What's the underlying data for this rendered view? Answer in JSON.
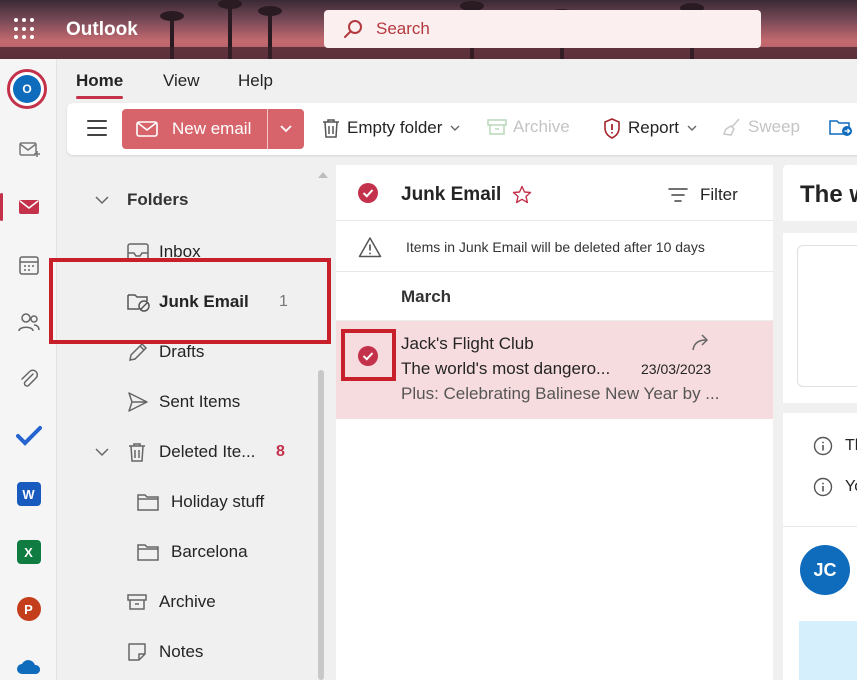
{
  "header": {
    "app_title": "Outlook",
    "search_placeholder": "Search"
  },
  "ribbon": {
    "tabs": [
      {
        "label": "Home",
        "active": true
      },
      {
        "label": "View"
      },
      {
        "label": "Help"
      }
    ]
  },
  "toolbar": {
    "new_email": "New email",
    "empty_folder": "Empty folder",
    "archive": "Archive",
    "report": "Report",
    "sweep": "Sweep"
  },
  "folders": {
    "section_title": "Folders",
    "items": [
      {
        "label": "Inbox",
        "icon": "inbox-icon"
      },
      {
        "label": "Junk Email",
        "count": "1",
        "selected": true,
        "icon": "junk-folder-icon"
      },
      {
        "label": "Drafts",
        "icon": "pencil-icon"
      },
      {
        "label": "Sent Items",
        "icon": "send-icon"
      },
      {
        "label": "Deleted Ite...",
        "count": "8",
        "icon": "trash-icon"
      },
      {
        "label": "Holiday stuff",
        "icon": "folder-icon"
      },
      {
        "label": "Barcelona",
        "icon": "folder-icon"
      },
      {
        "label": "Archive",
        "icon": "archive-icon"
      },
      {
        "label": "Notes",
        "icon": "note-icon"
      }
    ]
  },
  "message_list": {
    "title": "Junk Email",
    "filter_label": "Filter",
    "warning": "Items in Junk Email will be deleted after 10 days",
    "section": "March",
    "messages": [
      {
        "sender": "Jack's Flight Club",
        "subject": "The world's most dangero...",
        "date": "23/03/2023",
        "preview": "Plus: Celebrating Balinese New Year by ..."
      }
    ]
  },
  "reading_pane": {
    "title_partial": "The w",
    "info_line_1": "Th",
    "info_line_2": "Yo",
    "avatar_initials": "JC"
  },
  "colors": {
    "accent": "#c4314b",
    "new_email_bg": "#d6646a",
    "selected_bg": "#f7dadd",
    "highlight_box": "#c8202b",
    "avatar_bg": "#0f6cbd"
  }
}
